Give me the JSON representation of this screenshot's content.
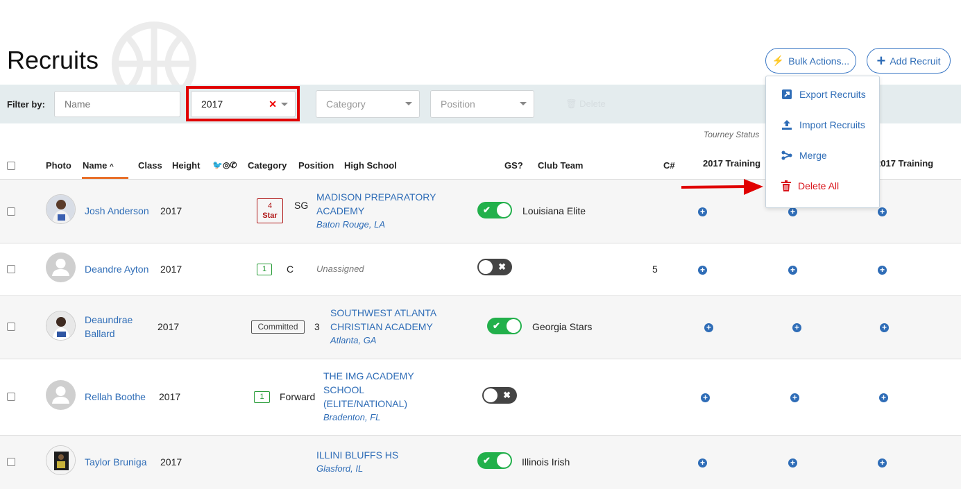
{
  "page": {
    "title": "Recruits"
  },
  "header": {
    "bulk_label": "Bulk Actions...",
    "add_label": "Add Recruit"
  },
  "filters": {
    "label": "Filter by:",
    "name_placeholder": "Name",
    "year_value": "2017",
    "category_placeholder": "Category",
    "position_placeholder": "Position",
    "delete_ghost": "Delete"
  },
  "tourney_status": "Tourney Status",
  "columns": {
    "photo": "Photo",
    "name": "Name",
    "class": "Class",
    "height": "Height",
    "category": "Category",
    "position": "Position",
    "high_school": "High School",
    "gs": "GS?",
    "club_team": "Club Team",
    "cnum": "C#",
    "training1": "2017 Training",
    "training3": "2017 Training"
  },
  "rows": [
    {
      "name": "Josh Anderson",
      "class": "2017",
      "category": "4 Star",
      "category_l1": "4",
      "category_l2": "Star",
      "category_type": "star",
      "position": "SG",
      "school_l1": "MADISON PREPARATORY",
      "school_l2": "ACADEMY",
      "school_l3": "",
      "city": "Baton Rouge, LA",
      "gs": true,
      "club": "Louisiana Elite",
      "cnum": "",
      "photo": "player"
    },
    {
      "name": "Deandre Ayton",
      "class": "2017",
      "category": "1",
      "category_type": "num",
      "position": "C",
      "school_l1": "Unassigned",
      "gs": false,
      "club": "",
      "cnum": "5",
      "photo": "placeholder"
    },
    {
      "name_l1": "Deaundrae",
      "name_l2": "Ballard",
      "class": "2017",
      "category": "Committed",
      "category_type": "committed",
      "position": "3",
      "school_l1": "SOUTHWEST ATLANTA",
      "school_l2": "CHRISTIAN ACADEMY",
      "city": "Atlanta, GA",
      "gs": true,
      "club": "Georgia Stars",
      "cnum": "",
      "photo": "player"
    },
    {
      "name": "Rellah Boothe",
      "class": "2017",
      "category": "1",
      "category_type": "num",
      "position": "Forward",
      "school_l1": "THE IMG ACADEMY",
      "school_l2": "SCHOOL",
      "school_l3": "(ELITE/NATIONAL)",
      "city": "Bradenton, FL",
      "gs": false,
      "club": "",
      "cnum": "",
      "photo": "placeholder"
    },
    {
      "name": "Taylor Bruniga",
      "class": "2017",
      "category": "",
      "position": "",
      "school_l1": "ILLINI BLUFFS HS",
      "city": "Glasford, IL",
      "gs": true,
      "club": "Illinois Irish",
      "cnum": "",
      "photo": "player"
    }
  ],
  "bulk_menu": [
    {
      "label": "Export Recruits",
      "icon": "export-icon"
    },
    {
      "label": "Import Recruits",
      "icon": "upload-icon"
    },
    {
      "label": "Merge",
      "icon": "merge-icon"
    },
    {
      "label": "Delete All",
      "icon": "trash-icon"
    }
  ],
  "colors": {
    "accent": "#2f6db7",
    "danger": "#d9141b",
    "toggle_on": "#22b04b",
    "toggle_off": "#444444",
    "highlight": "#e00000"
  }
}
